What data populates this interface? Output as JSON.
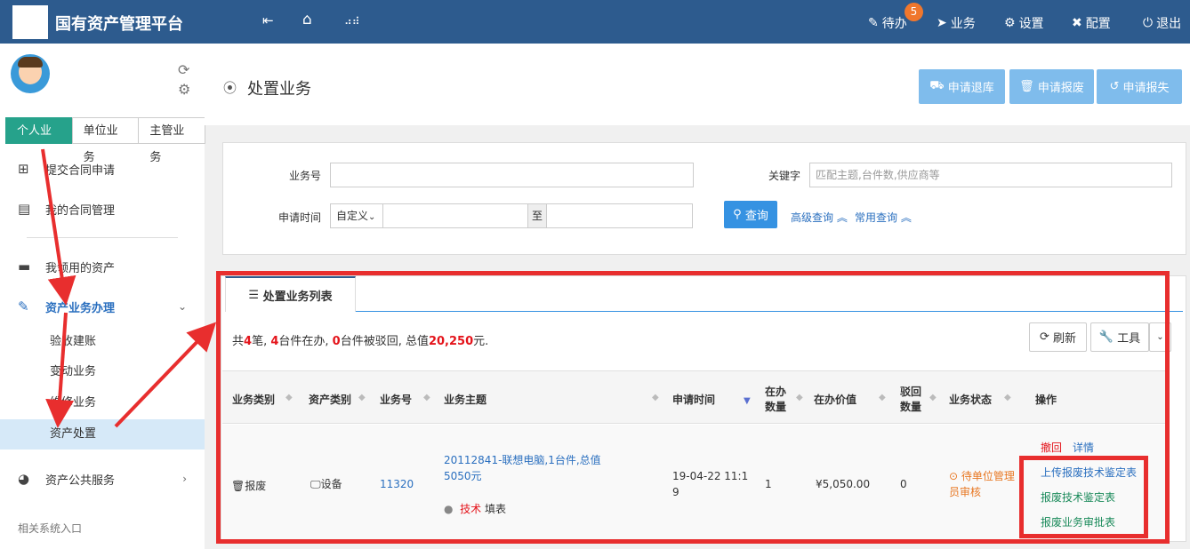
{
  "app": {
    "title": "国有资产管理平台"
  },
  "topnav": {
    "todo": "待办",
    "todo_count": "5",
    "business": "业务",
    "settings": "设置",
    "config": "配置",
    "logout": "退出"
  },
  "sidebar": {
    "tabs": [
      "个人业务",
      "单位业务",
      "主管业务"
    ],
    "items": {
      "submit_contract": "提交合同申请",
      "my_contracts": "我的合同管理",
      "my_assets": "我领用的资产",
      "asset_business": "资产业务办理",
      "public_service": "资产公共服务"
    },
    "sub_items": [
      "验收建账",
      "变动业务",
      "维修业务",
      "资产处置"
    ],
    "related": "相关系统入口"
  },
  "page": {
    "title": "处置业务"
  },
  "actions": {
    "return": "申请退库",
    "scrap": "申请报废",
    "lost": "申请报失"
  },
  "search": {
    "business_no_label": "业务号",
    "keyword_label": "关键字",
    "keyword_placeholder": "匹配主题,台件数,供应商等",
    "date_label": "申请时间",
    "date_mode": "自定义",
    "to_label": "至",
    "query_btn": "查询",
    "advanced": "高级查询",
    "common": "常用查询"
  },
  "list": {
    "tab": "处置业务列表",
    "summary": {
      "p1": "共",
      "count": "4",
      "p2": "笔, ",
      "active": "4",
      "p3": "台件在办, ",
      "returned": "0",
      "p4": "台件被驳回, 总值",
      "total": "20,250",
      "p5": "元."
    },
    "refresh": "刷新",
    "tools": "工具",
    "columns": [
      "业务类别",
      "资产类别",
      "业务号",
      "业务主题",
      "申请时间",
      "在办数量",
      "在办价值",
      "驳回数量",
      "业务状态",
      "操作"
    ],
    "rows": [
      {
        "category": "报废",
        "asset_type": "设备",
        "business_no": "11320",
        "subject": "20112841-联想电脑,1台件,总值5050元",
        "step_role": "技术",
        "step_action": "填表",
        "apply_time": "19-04-22 11:19",
        "qty": "1",
        "value": "¥5,050.00",
        "rejected": "0",
        "status": "待单位管理员审核",
        "op_revoke": "撤回",
        "op_detail": "详情",
        "op_upload": "上传报废技术鉴定表",
        "op_tech": "报废技术鉴定表",
        "op_approve": "报废业务审批表"
      }
    ]
  }
}
